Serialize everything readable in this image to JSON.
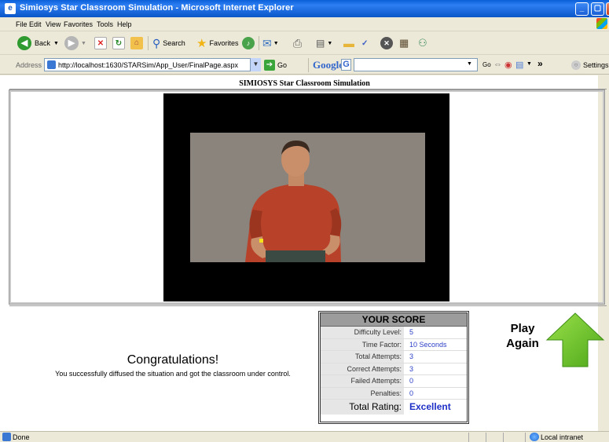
{
  "window": {
    "title": "Simiosys Star Classroom Simulation - Microsoft Internet Explorer",
    "buttons": {
      "minimize": "_",
      "maximize": "▢",
      "close": "✕"
    }
  },
  "menu": [
    "File",
    "Edit",
    "View",
    "Favorites",
    "Tools",
    "Help"
  ],
  "toolbar": {
    "back_label": "Back",
    "search_label": "Search",
    "favorites_label": "Favorites"
  },
  "address": {
    "label": "Address",
    "url": "http://localhost:1630/STARSim/App_User/FinalPage.aspx",
    "go_label": "Go",
    "google_label": "Google",
    "g_label": "G",
    "google_go_label": "Go",
    "settings_label": "Settings"
  },
  "page": {
    "header": "SIMIOSYS Star Classroom Simulation",
    "congrats_title": "Congratulations!",
    "congrats_sub": "You successfully diffused the situation and got the classroom under control.",
    "play_again_line1": "Play",
    "play_again_line2": "Again"
  },
  "score": {
    "title": "YOUR SCORE",
    "rows": [
      {
        "label": "Difficulty Level:",
        "value": "5"
      },
      {
        "label": "Time Factor:",
        "value": "10 Seconds"
      },
      {
        "label": "Total Attempts:",
        "value": "3"
      },
      {
        "label": "Correct Attempts:",
        "value": "3"
      },
      {
        "label": "Failed Attempts:",
        "value": "0"
      },
      {
        "label": "Penalties:",
        "value": "0"
      }
    ],
    "total_label": "Total Rating:",
    "total_value": "Excellent"
  },
  "status": {
    "text": "Done",
    "zone": "Local intranet"
  },
  "colors": {
    "accent_blue": "#2b3fc7",
    "play_arrow": "#6cc326",
    "titlebar": "#0a5fd8"
  }
}
